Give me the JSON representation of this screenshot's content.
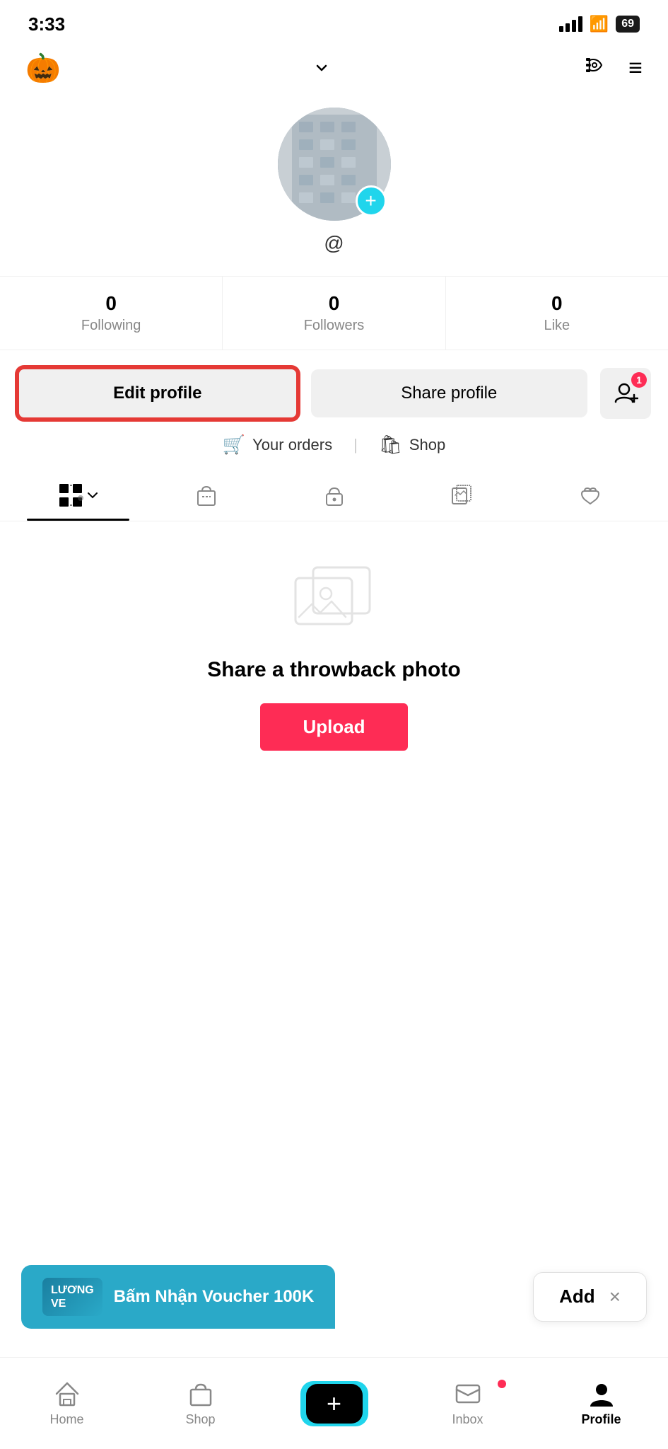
{
  "statusBar": {
    "time": "3:33",
    "battery": "69"
  },
  "topNav": {
    "emoji": "🎃",
    "chevron": "∨",
    "lensIcon": "⌘",
    "menuIcon": "☰"
  },
  "profile": {
    "usernameSymbol": "@",
    "addButtonLabel": "+"
  },
  "stats": [
    {
      "number": "",
      "label": "Following"
    },
    {
      "number": "",
      "label": "Followers"
    },
    {
      "number": "",
      "label": "Like"
    }
  ],
  "buttons": {
    "editProfile": "Edit profile",
    "shareProfile": "Share profile",
    "addFriendBadge": "1"
  },
  "orders": {
    "yourOrders": "Your orders",
    "shop": "Shop",
    "divider": "|"
  },
  "tabs": [
    {
      "icon": "grid",
      "active": true
    },
    {
      "icon": "bag",
      "active": false
    },
    {
      "icon": "lock",
      "active": false
    },
    {
      "icon": "album",
      "active": false
    },
    {
      "icon": "heart",
      "active": false
    }
  ],
  "throwback": {
    "title": "Share a throwback photo",
    "uploadBtn": "Upload"
  },
  "phoneBanner": {
    "logoLine1": "LƯƠNG",
    "logoLine2": "VE",
    "text": "Bấm Nhận Voucher 100K",
    "addLabel": "Add",
    "closeLabel": "×"
  },
  "bottomNav": {
    "home": "Home",
    "shop": "Shop",
    "plus": "+",
    "inbox": "Inbox",
    "profile": "Profile"
  }
}
